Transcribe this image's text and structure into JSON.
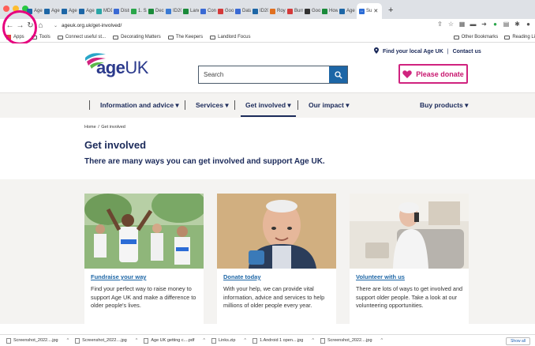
{
  "browser": {
    "tabs": [
      {
        "label": "Age",
        "color": "#1d66a6"
      },
      {
        "label": "Age",
        "color": "#1d66a6"
      },
      {
        "label": "Age",
        "color": "#1d66a6"
      },
      {
        "label": "Age",
        "color": "#1d66a6"
      },
      {
        "label": "MDD",
        "color": "#2aa6a6"
      },
      {
        "label": "Distr",
        "color": "#3a6ad4"
      },
      {
        "label": "1. SA",
        "color": "#2aa64a"
      },
      {
        "label": "Deco",
        "color": "#1a8a3a"
      },
      {
        "label": "ID20",
        "color": "#3a7ad4"
      },
      {
        "label": "Land",
        "color": "#1a8a3a"
      },
      {
        "label": "Cons",
        "color": "#3a6ad4"
      },
      {
        "label": "Goog",
        "color": "#d43a3a"
      },
      {
        "label": "Datal",
        "color": "#3a6ad4"
      },
      {
        "label": "ID20",
        "color": "#1d66a6"
      },
      {
        "label": "Royal",
        "color": "#e07020"
      },
      {
        "label": "Burnl",
        "color": "#d43a3a"
      },
      {
        "label": "Goog",
        "color": "#333333"
      },
      {
        "label": "How",
        "color": "#1a8a3a"
      },
      {
        "label": "Age",
        "color": "#1d66a6"
      }
    ],
    "active_tab": {
      "label": "Su",
      "close": "✕"
    },
    "new_tab": "+",
    "url": "ageuk.org.uk/get-involved/",
    "bookmarks": {
      "apps": "Apps",
      "items": [
        "Tools",
        "Connect useful st...",
        "Decorating Matters",
        "The Keepers",
        "Landlord Focus"
      ],
      "other": "Other Bookmarks",
      "reading": "Reading Li"
    },
    "downloads": [
      {
        "name": "Screenshot_2022....jpg"
      },
      {
        "name": "Screenshot_2022....jpg"
      },
      {
        "name": "Age UK getting c....pdf"
      },
      {
        "name": "Links.zip"
      },
      {
        "name": "1.Android 1 open....jpg"
      },
      {
        "name": "Screenshot_2022....jpg"
      }
    ],
    "show_all": "Show all"
  },
  "header": {
    "logo_text": "age",
    "logo_uk": "UK",
    "find_local": "Find your local Age UK",
    "contact": "Contact us",
    "search_placeholder": "Search",
    "donate_label": "Please donate"
  },
  "nav": {
    "items": [
      {
        "label": "Information and advice"
      },
      {
        "label": "Services"
      },
      {
        "label": "Get involved"
      },
      {
        "label": "Our impact"
      },
      {
        "label": "Buy products"
      }
    ]
  },
  "page": {
    "breadcrumb_home": "Home",
    "breadcrumb_current": "Get involved",
    "title": "Get involved",
    "subtitle": "There are many ways you can get involved and support Age UK."
  },
  "cards": [
    {
      "title": "Fundraise your way",
      "text": "Find your perfect way to raise money to support Age UK and make a difference to older people's lives."
    },
    {
      "title": "Donate today",
      "text": "With your help, we can provide vital information, advice and services to help millions of older people every year."
    },
    {
      "title": "Volunteer with us",
      "text": "There are lots of ways to get involved and support older people. Take a look at our volunteering opportunities."
    }
  ],
  "colors": {
    "brand_navy": "#1b2a5a",
    "link_blue": "#1d66a6",
    "donate_pink": "#d0237f",
    "annotation": "#e6007e"
  }
}
